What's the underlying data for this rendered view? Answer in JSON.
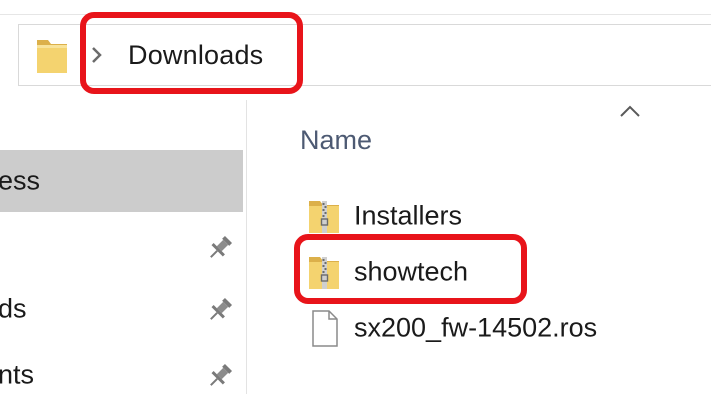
{
  "address_bar": {
    "breadcrumb": "Downloads",
    "folder_icon": "folder-icon",
    "separator_icon": "chevron-right-icon"
  },
  "navigation": {
    "items": [
      {
        "label": "ess",
        "selected": true,
        "pinned": false
      },
      {
        "label": "",
        "selected": false,
        "pinned": true,
        "icon": "pin-icon"
      },
      {
        "label": "ds",
        "selected": false,
        "pinned": true,
        "icon": "pin-icon"
      },
      {
        "label": "nts",
        "selected": false,
        "pinned": true,
        "icon": "pin-icon"
      }
    ]
  },
  "file_list": {
    "column_header": "Name",
    "sort_icon": "sort-up-icon",
    "files": [
      {
        "name": "Installers",
        "icon": "zip-folder-icon"
      },
      {
        "name": "showtech",
        "icon": "zip-folder-icon"
      },
      {
        "name": "sx200_fw-14502.ros",
        "icon": "file-icon"
      }
    ]
  },
  "highlights": {
    "color": "#e8141a",
    "targets": [
      "address-breadcrumb",
      "file-showtech"
    ]
  },
  "colors": {
    "selection": "#cccccc",
    "header_text": "#4d5a73",
    "folder_yellow": "#f4d36f"
  }
}
